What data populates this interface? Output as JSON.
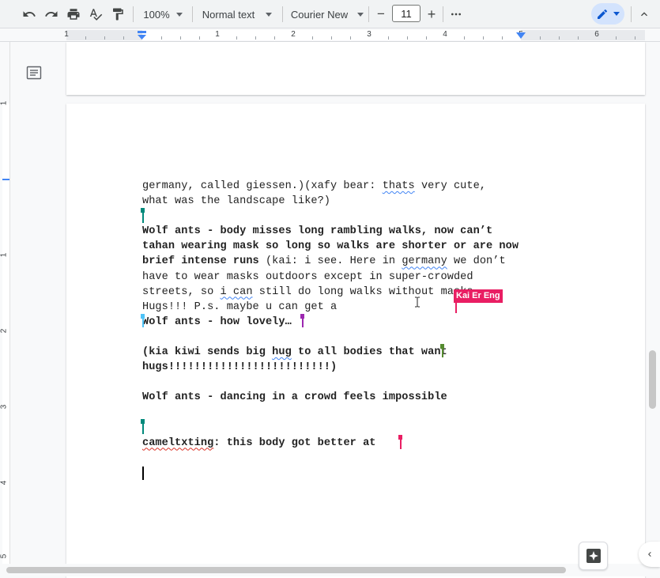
{
  "toolbar": {
    "zoom": "100%",
    "style": "Normal text",
    "font": "Courier New",
    "font_size": "11",
    "minus": "−",
    "plus": "+"
  },
  "ruler": {
    "numbers": [
      "1",
      "1",
      "2",
      "3",
      "4",
      "5",
      "6"
    ],
    "vertical_numbers": [
      "1",
      "2",
      "3",
      "4",
      "5"
    ]
  },
  "document": {
    "line1": "germany, called giessen.)(xafy bear: ",
    "line1_spell": "thats",
    "line1_rest": " very cute,",
    "line2": "what was the landscape like?)",
    "p2_bold": "Wolf ants - body misses long rambling walks, now can’t tahan wearing mask so long so walks are shorter or are now brief intense runs",
    "p2_normal_a": " (kai: i see. Here in ",
    "p2_spell_germany": "germany",
    "p2_normal_b": " we don’t have to wear masks outdoors except in super-crowded streets, so ",
    "p2_spell_ican": "i can",
    "p2_normal_c": " still do long walks without masks. Hugs!!! P.s. maybe u can get a",
    "p3_bold": "Wolf ants - how lovely…",
    "p4_a": "(kia kiwi sends big ",
    "p4_spell": "hug",
    "p4_b": " to all bodies that want hugs!!!!!!!!!!!!!!!!!!!!!!!!!)",
    "p5_bold": "Wolf ants - dancing in a crowd feels impossible",
    "p6_spell": "cameltxting",
    "p6_rest": ": this body got better at "
  },
  "collaborator": {
    "name": "Kai Er Eng",
    "color": "#e91e63"
  },
  "cursor_colors": {
    "teal": "#00897b",
    "blue": "#4fc3f7",
    "purple": "#9c27b0",
    "olive": "#558b2f",
    "pink": "#e91e63",
    "black": "#000000"
  }
}
